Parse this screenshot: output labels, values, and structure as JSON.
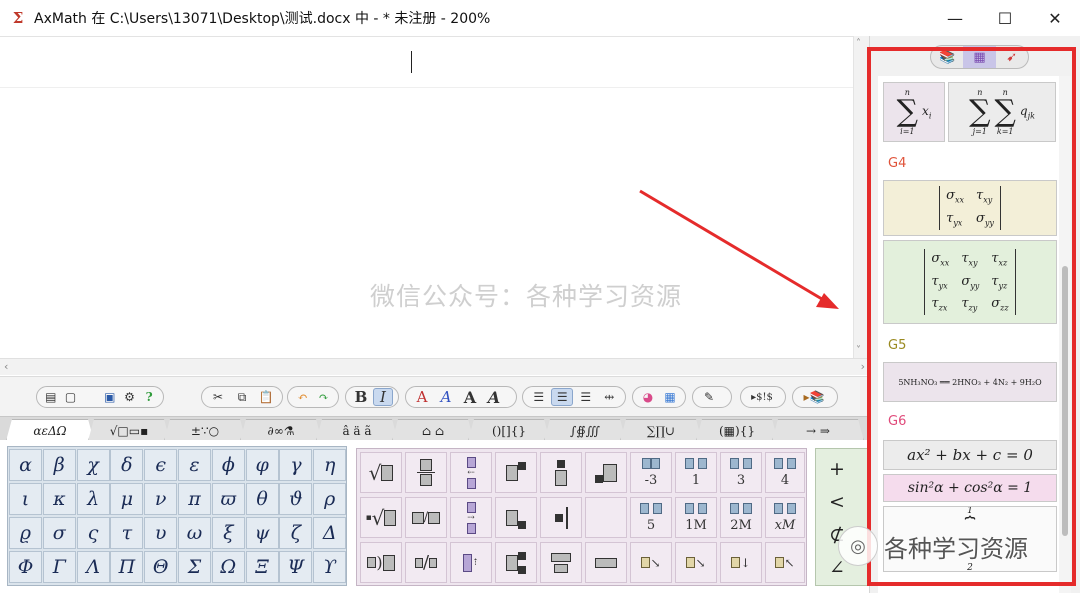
{
  "window": {
    "title": "AxMath 在 C:\\Users\\13071\\Desktop\\测试.docx 中 - * 未注册 - 200%",
    "app_icon": "sigma-app-icon",
    "controls": {
      "minimize": "—",
      "maximize": "☐",
      "close": "✕"
    }
  },
  "editor": {
    "watermark": "微信公众号：各种学习资源"
  },
  "toolbar": {
    "bold": "B",
    "italic": "I",
    "font_a_labels": [
      "A",
      "A",
      "A",
      "A"
    ]
  },
  "category_tabs": [
    "αεΔΩ",
    "√□▭▪",
    "±∵○",
    "∂∞⚗",
    "â ä ã",
    "⌂ ⌂",
    "()[]{}",
    "∫∯∭",
    "∑∏∪",
    "(▦){}",
    "→ ⇒"
  ],
  "greek": [
    [
      "α",
      "β",
      "χ",
      "δ",
      "ϵ",
      "ε",
      "ϕ",
      "φ",
      "γ",
      "η"
    ],
    [
      "ι",
      "κ",
      "λ",
      "μ",
      "ν",
      "π",
      "ϖ",
      "θ",
      "ϑ",
      "ρ"
    ],
    [
      "ϱ",
      "σ",
      "ς",
      "τ",
      "υ",
      "ω",
      "ξ",
      "ψ",
      "ζ",
      "Δ"
    ],
    [
      "Φ",
      "Γ",
      "Λ",
      "Π",
      "Θ",
      "Σ",
      "Ω",
      "Ξ",
      "Ψ",
      "ϒ"
    ]
  ],
  "struct_labels": {
    "row1": [
      "-3",
      "1",
      "3",
      "4"
    ],
    "row2": [
      "5",
      "1M",
      "2M",
      "xM"
    ]
  },
  "relations": [
    "+",
    "<",
    "⊄",
    "∠"
  ],
  "right_panel": {
    "groups": [
      {
        "label": "G4",
        "color": "#e0533a"
      },
      {
        "label": "G5",
        "color": "#9a8a20"
      },
      {
        "label": "G6",
        "color": "#e04a7a"
      }
    ],
    "sum1": {
      "upper": "n",
      "lower": "i=1",
      "term": "x",
      "sub": "i"
    },
    "sum2": {
      "upper1": "n",
      "lower1": "j=1",
      "upper2": "n",
      "lower2": "k=1",
      "term": "q",
      "sub": "jk"
    },
    "matrix2": [
      [
        "σ",
        "xx",
        "τ",
        "xy"
      ],
      [
        "τ",
        "yx",
        "σ",
        "yy"
      ]
    ],
    "matrix3": [
      [
        "σ",
        "xx",
        "τ",
        "xy",
        "τ",
        "xz"
      ],
      [
        "τ",
        "yx",
        "σ",
        "yy",
        "τ",
        "yz"
      ],
      [
        "τ",
        "zx",
        "τ",
        "zy",
        "σ",
        "zz"
      ]
    ],
    "reaction": "5NH₃NO₃ ══ 2HNO₃ + 4N₂ + 9H₂O",
    "quadratic": "ax² + bx + c = 0",
    "trig": "sin²α + cos²α = 1",
    "fraction_top": "1",
    "fraction_bottom": "2"
  },
  "wechat_badge": "各种学习资源"
}
